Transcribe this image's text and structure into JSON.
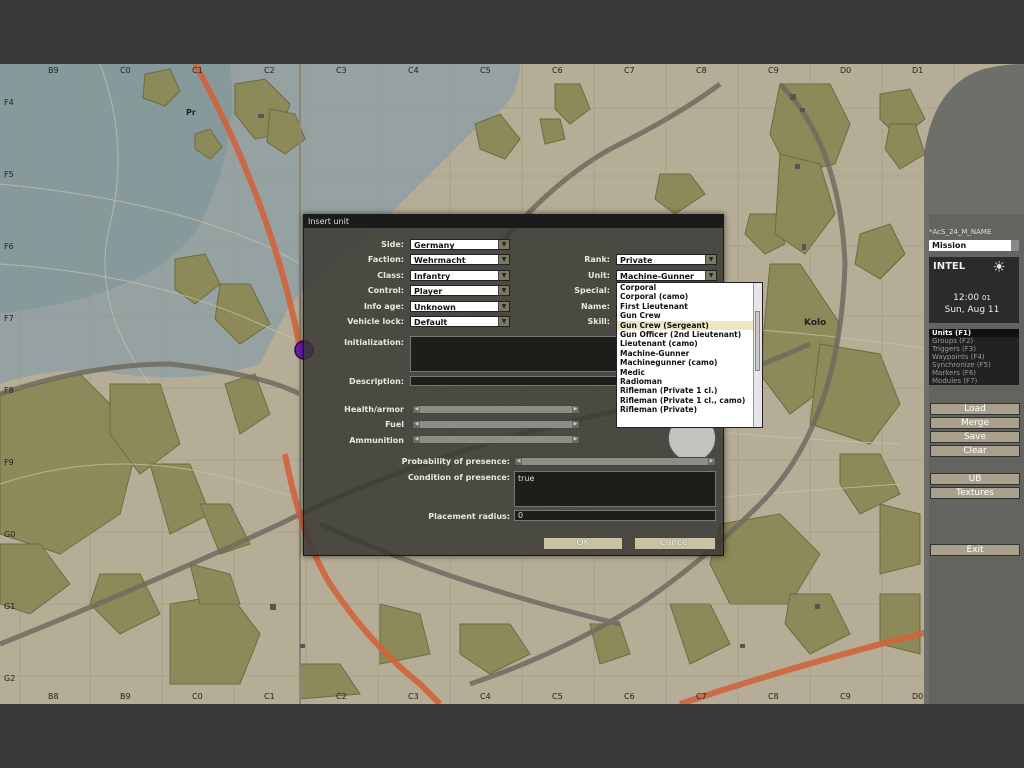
{
  "map": {
    "grid_top_labels": [
      "B9",
      "C0",
      "C1",
      "C2",
      "C3",
      "C4",
      "C5",
      "C6",
      "C7",
      "C8",
      "C9",
      "D0",
      "D1"
    ],
    "grid_bottom_labels": [
      "B8",
      "B9",
      "C0",
      "C1",
      "C2",
      "C3",
      "C4",
      "C5",
      "C6",
      "C7",
      "C8",
      "C9",
      "D0"
    ],
    "grid_left_labels": [
      "F4",
      "F5",
      "F6",
      "F7",
      "F8",
      "F9",
      "G0",
      "G1",
      "G2"
    ],
    "place_labels": [
      "Pr",
      "Kolo"
    ]
  },
  "dialog": {
    "title": "Insert unit",
    "fields": {
      "side": {
        "label": "Side:",
        "value": "Germany"
      },
      "faction": {
        "label": "Faction:",
        "value": "Wehrmacht"
      },
      "class": {
        "label": "Class:",
        "value": "Infantry"
      },
      "control": {
        "label": "Control:",
        "value": "Player"
      },
      "info_age": {
        "label": "Info age:",
        "value": "Unknown"
      },
      "vehicle_lock": {
        "label": "Vehicle lock:",
        "value": "Default"
      },
      "rank": {
        "label": "Rank:",
        "value": "Private"
      },
      "unit": {
        "label": "Unit:",
        "value": "Machine-Gunner"
      },
      "special": {
        "label": "Special:"
      },
      "name": {
        "label": "Name:"
      },
      "skill": {
        "label": "Skill:"
      },
      "initialization": {
        "label": "Initialization:"
      },
      "description": {
        "label": "Description:"
      },
      "health": {
        "label": "Health/armor"
      },
      "fuel": {
        "label": "Fuel"
      },
      "ammo": {
        "label": "Ammunition"
      },
      "probability": {
        "label": "Probability of presence:"
      },
      "condition": {
        "label": "Condition of presence:",
        "value": "true"
      },
      "placement": {
        "label": "Placement radius:",
        "value": "0"
      }
    },
    "buttons": {
      "ok": "OK",
      "cancel": "Cancel"
    }
  },
  "unit_dropdown": {
    "items": [
      "Corporal",
      "Corporal (camo)",
      "First Lieutenant",
      "Gun Crew",
      "Gun Crew (Sergeant)",
      "Gun Officer (2nd Lieutenant)",
      "Lieutenant (camo)",
      "Machine-Gunner",
      "Machinegunner (camo)",
      "Medic",
      "Radioman",
      "Rifleman (Private 1 cl.)",
      "Rifleman (Private 1 cl., camo)",
      "Rifleman (Private)"
    ],
    "highlighted_index": 4
  },
  "side_panel": {
    "mission_name": "*AcS_24_M_NAME",
    "mode": "Mission",
    "intel": {
      "title": "INTEL",
      "time": "12:00",
      "time_suffix": "01",
      "date": "Sun, Aug 11"
    },
    "modes": [
      "Units (F1)",
      "Groups (F2)",
      "Triggers (F3)",
      "Waypoints (F4)",
      "Synchronize (F5)",
      "Markers (F6)",
      "Modules (F7)"
    ],
    "active_mode_index": 0,
    "buttons": [
      "Load",
      "Merge",
      "Save",
      "Clear",
      "UB",
      "Textures",
      "Exit"
    ]
  },
  "colors": {
    "map_bg": "#b5ad95",
    "forest": "#8b8a58",
    "road": "#7a7768",
    "red_road": "#d0633c",
    "highlight": "#ece7c0"
  }
}
